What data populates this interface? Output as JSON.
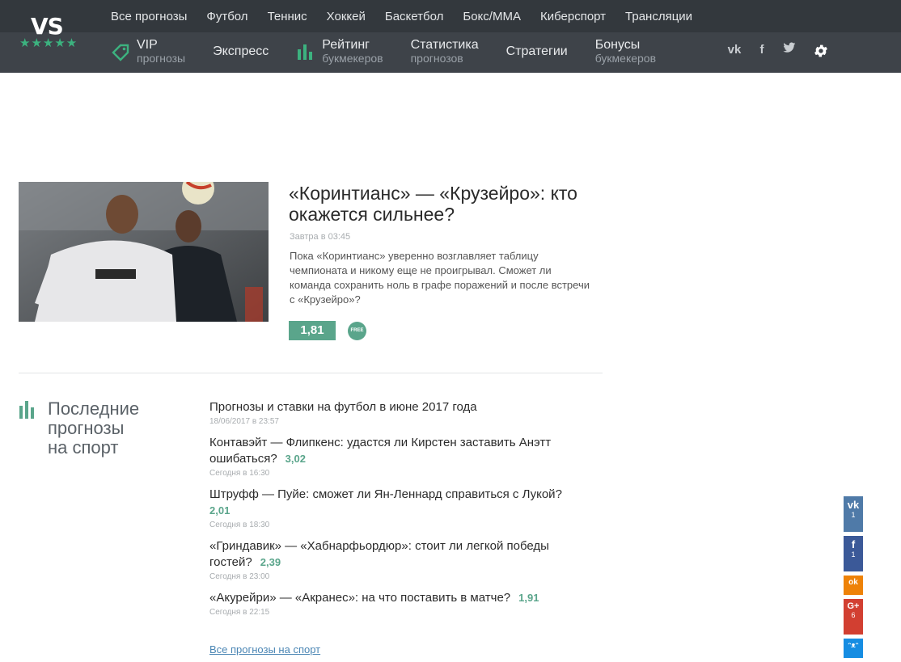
{
  "logo": {
    "text": "VS",
    "stars": "★★★★★"
  },
  "topnav": [
    "Все прогнозы",
    "Футбол",
    "Теннис",
    "Хоккей",
    "Баскетбол",
    "Бокс/MMA",
    "Киберспорт",
    "Трансляции"
  ],
  "subnav": {
    "vip": {
      "title": "VIP",
      "sub": "прогнозы"
    },
    "express": {
      "title": "Экспресс"
    },
    "rating": {
      "title": "Рейтинг",
      "sub": "букмекеров"
    },
    "stats": {
      "title": "Статистика",
      "sub": "прогнозов"
    },
    "strategies": {
      "title": "Стратегии"
    },
    "bonuses": {
      "title": "Бонусы",
      "sub": "букмекеров"
    }
  },
  "social_top": {
    "vk": "vk",
    "fb": "f"
  },
  "featured": {
    "title": "«Коринтианс» — «Крузейро»: кто окажется сильнее?",
    "date": "Завтра в 03:45",
    "description": "Пока «Коринтианс» уверенно возглавляет таблицу чемпионата и никому еще не проигрывал. Сможет ли команда сохранить ноль в графе поражений и после встречи с «Крузейро»?",
    "odds": "1,81",
    "badge": "FREE"
  },
  "latest": {
    "title_lines": [
      "Последние",
      "прогнозы",
      "на спорт"
    ],
    "items": [
      {
        "title": "Прогнозы и ставки на футбол в июне 2017 года",
        "odds": "",
        "date": "18/06/2017 в 23:57"
      },
      {
        "title": "Контавэйт — Флипкенс: удастся ли Кирстен заставить Анэтт ошибаться?",
        "odds": "3,02",
        "date": "Сегодня в 16:30"
      },
      {
        "title": "Штруфф — Пуйе: сможет ли Ян-Леннард справиться с Лукой?",
        "odds": "2,01",
        "date": "Сегодня в 18:30"
      },
      {
        "title": "«Гриндавик» — «Хабнарфьордюр»: стоит ли легкой победы гостей?",
        "odds": "2,39",
        "date": "Сегодня в 23:00"
      },
      {
        "title": "«Акурейри» — «Акранес»: на что поставить в матче?",
        "odds": "1,91",
        "date": "Сегодня в 22:15"
      }
    ],
    "all_link": "Все прогнозы на спорт"
  },
  "share": {
    "vk": {
      "glyph": "vk",
      "count": "1"
    },
    "fb": {
      "glyph": "f",
      "count": "1"
    },
    "ok": {
      "glyph": "ok"
    },
    "gp": {
      "glyph": "G+",
      "count": "6"
    },
    "mm": {
      "glyph": "ᵔᴥᵔ"
    }
  },
  "colors": {
    "header": "#3e4349",
    "topbar": "#33383d",
    "accent": "#5aa58b",
    "link": "#4b86b4"
  }
}
